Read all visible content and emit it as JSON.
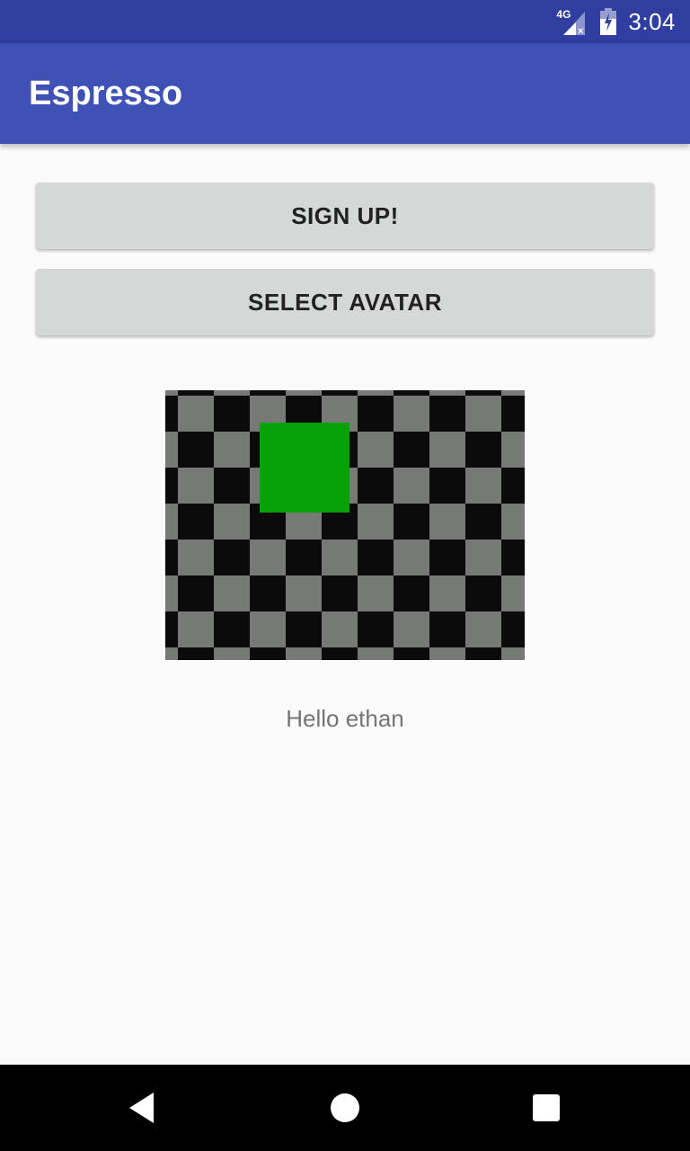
{
  "status_bar": {
    "network": "4G",
    "time": "3:04"
  },
  "app_bar": {
    "title": "Espresso"
  },
  "buttons": {
    "sign_up": "SIGN UP!",
    "select_avatar": "SELECT AVATAR"
  },
  "avatar": {
    "square_color": "#07a207",
    "checker_dark": "#0b0b0b",
    "checker_light": "#767976"
  },
  "greeting": "Hello ethan",
  "colors": {
    "status_bar": "#303f9f",
    "app_bar": "#3f51b5",
    "button": "#d6d7d7",
    "background": "#fafafa"
  },
  "nav_bar": {
    "icons": [
      "back-icon",
      "home-icon",
      "recents-icon"
    ]
  }
}
